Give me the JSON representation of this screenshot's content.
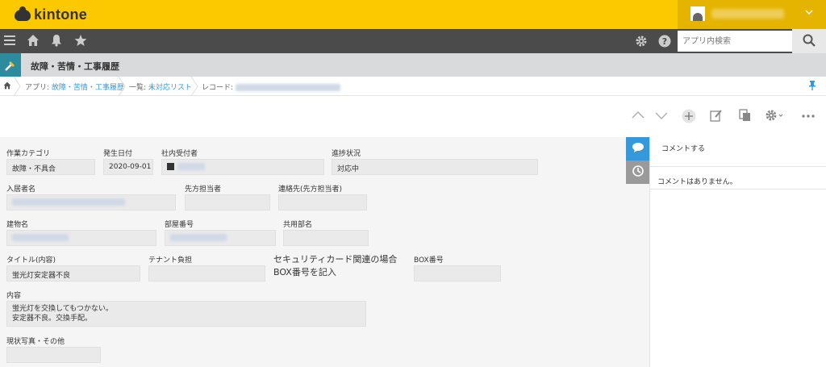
{
  "header": {
    "logo_text": "kintone",
    "accent": "#fcc800"
  },
  "nav": {
    "search_placeholder": "アプリ内検索",
    "icons": [
      "menu-icon",
      "home-icon",
      "bell-icon",
      "star-icon",
      "gear-icon",
      "help-icon",
      "search-icon"
    ]
  },
  "app": {
    "title": "故障・苦情・工事履歴"
  },
  "breadcrumb": {
    "app_prefix": "アプリ:",
    "app_name": "故障・苦情・工事履歴",
    "view_prefix": "一覧:",
    "view_name": "未対応リスト",
    "record_prefix": "レコード:"
  },
  "form": {
    "category_label": "作業カテゴリ",
    "category_value": "故障・不具合",
    "date_label": "発生日付",
    "date_value": "2020-09-01",
    "receiver_label": "社内受付者",
    "status_label": "進捗状況",
    "status_value": "対応中",
    "resident_label": "入居者名",
    "contact_person_label": "先方担当者",
    "contact_label": "連絡先(先方担当者)",
    "building_label": "建物名",
    "room_label": "部屋番号",
    "shared_label": "共用部名",
    "title_label": "タイトル(内容)",
    "title_value": "蛍光灯安定器不良",
    "tenant_label": "テナント負担",
    "security_label_line1": "セキュリティカード関連の場合",
    "security_label_line2": "BOX番号を記入",
    "box_label": "BOX番号",
    "content_label": "内容",
    "content_line1": "蛍光灯を交換してもつかない。",
    "content_line2": "安定器不良。交換手配。",
    "photo_label": "現状写真・その他"
  },
  "comments": {
    "post_label": "コメントする",
    "empty_text": "コメントはありません。"
  }
}
